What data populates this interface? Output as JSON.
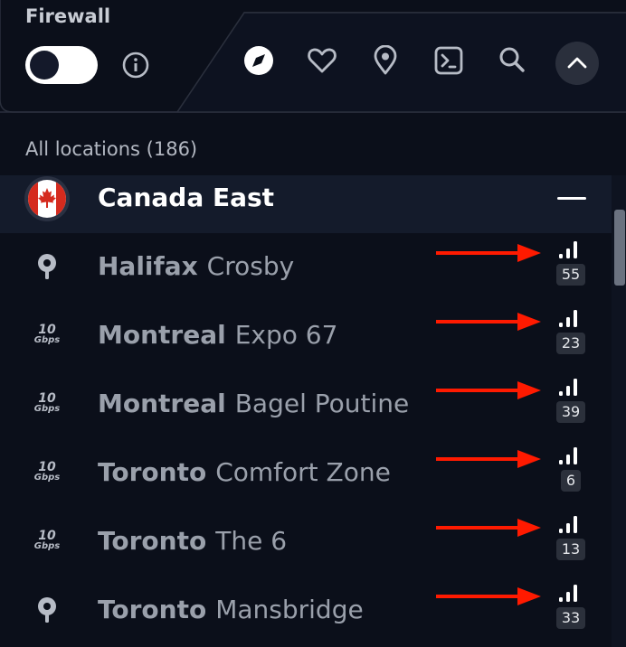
{
  "header": {
    "firewall_label": "Firewall",
    "firewall_enabled": false,
    "nav_icons": [
      "compass-icon",
      "heart-icon",
      "location-pin-icon",
      "terminal-icon",
      "search-icon"
    ],
    "collapse_icon": "chevron-up-icon"
  },
  "list": {
    "all_locations_label": "All locations (186)",
    "region": {
      "name": "Canada East",
      "flag": "canada-flag-icon"
    },
    "servers": [
      {
        "city": "Halifax",
        "name": "Crosby",
        "icon": "location-pin-icon",
        "load": "55"
      },
      {
        "city": "Montreal",
        "name": "Expo 67",
        "icon": "10gbps-icon",
        "load": "23"
      },
      {
        "city": "Montreal",
        "name": "Bagel Poutine",
        "icon": "10gbps-icon",
        "load": "39"
      },
      {
        "city": "Toronto",
        "name": "Comfort Zone",
        "icon": "10gbps-icon",
        "load": "6"
      },
      {
        "city": "Toronto",
        "name": "The 6",
        "icon": "10gbps-icon",
        "load": "13"
      },
      {
        "city": "Toronto",
        "name": "Mansbridge",
        "icon": "location-pin-icon",
        "load": "33"
      }
    ],
    "gbps_icon_text": {
      "number": "10",
      "unit": "Gbps"
    }
  },
  "colors": {
    "background": "#0b0f1a",
    "annotation_arrow": "#ff1a00",
    "flag_red": "#d52b1e"
  }
}
